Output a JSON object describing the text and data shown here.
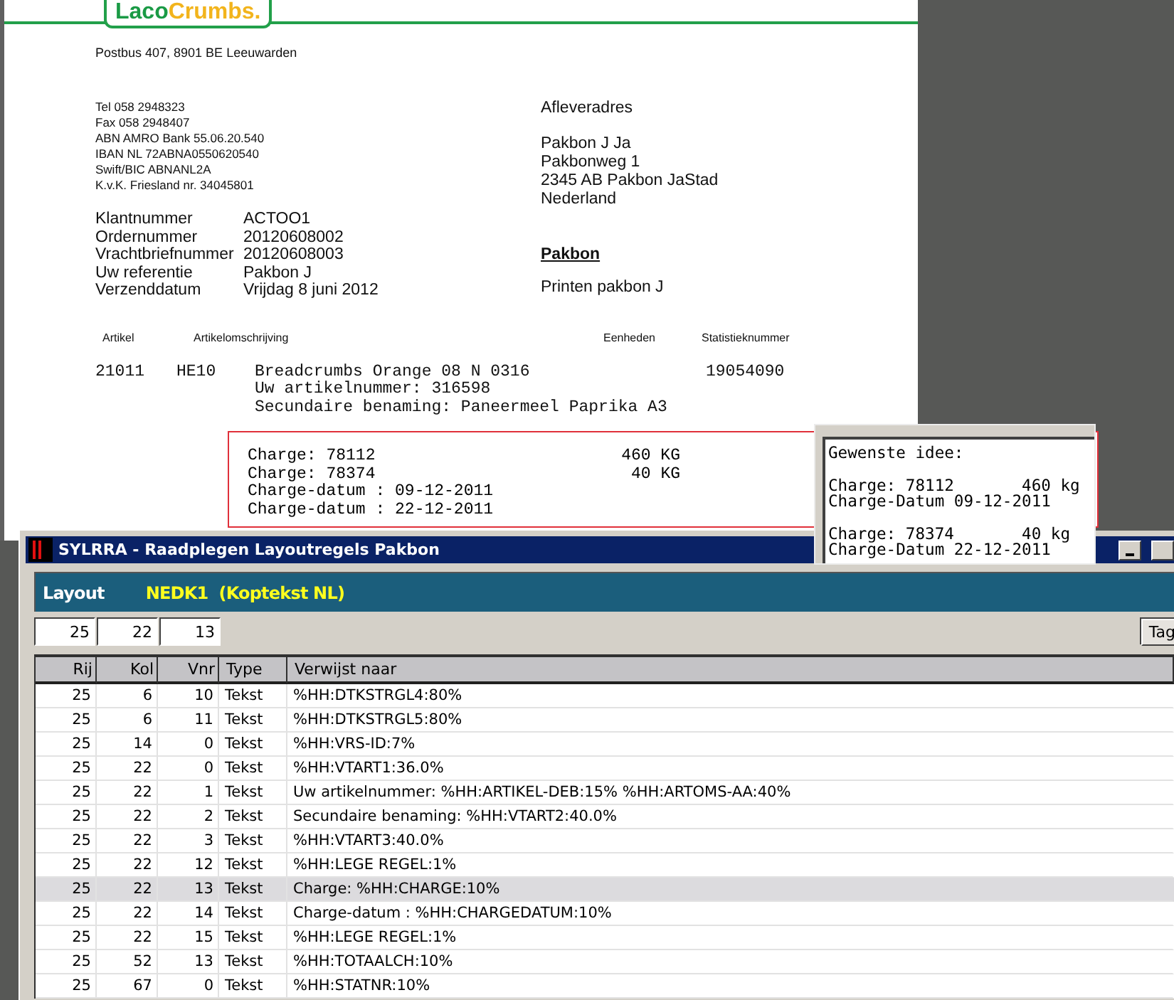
{
  "document": {
    "logo": {
      "first": "Laco",
      "second": "Crumbs."
    },
    "postal_address": "Postbus 407, 8901 BE Leeuwarden",
    "contact_lines": [
      "Tel 058 2948323",
      "Fax 058 2948407",
      "ABN AMRO Bank 55.06.20.540",
      "IBAN NL 72ABNA0550620540",
      "Swift/BIC ABNANL2A",
      "K.v.K. Friesland nr. 34045801"
    ],
    "order_fields": [
      {
        "label": "Klantnummer",
        "value": "ACTOO1"
      },
      {
        "label": "Ordernummer",
        "value": "20120608002"
      },
      {
        "label": "Vrachtbriefnummer",
        "value": "20120608003"
      },
      {
        "label": "Uw referentie",
        "value": "Pakbon J"
      },
      {
        "label": "Verzenddatum",
        "value": "Vrijdag 8 juni 2012"
      }
    ],
    "delivery": {
      "heading": "Afleveradres",
      "lines": [
        "Pakbon J Ja",
        "Pakbonweg 1",
        "2345 AB  Pakbon JaStad",
        "Nederland"
      ]
    },
    "doc_title": "Pakbon",
    "doc_subtitle": "Printen pakbon J",
    "columns": [
      "Artikel",
      "Artikelomschrijving",
      "Eenheden",
      "Statistieknummer"
    ],
    "item": {
      "article": "21011",
      "code": "HE10",
      "description_lines": [
        "Breadcrumbs Orange 08 N 0316",
        "Uw artikelnummer: 316598",
        "Secundaire benaming: Paneermeel Paprika A3"
      ],
      "stat_number": "19054090"
    }
  },
  "charges": [
    {
      "text": "Charge: 78112",
      "amount": "460 KG"
    },
    {
      "text": "Charge: 78374",
      "amount": "40 KG"
    },
    {
      "text": "Charge-datum : 09-12-2011"
    },
    {
      "text": "Charge-datum : 22-12-2011"
    }
  ],
  "note": {
    "blocks": [
      [
        "Gewenste idee:"
      ],
      [
        "Charge: 78112       460 kg",
        "Charge-Datum 09-12-2011"
      ],
      [
        "Charge: 78374       40 kg",
        "Charge-Datum 22-12-2011"
      ]
    ]
  },
  "app_window": {
    "title": "SYLRRA - Raadplegen Layoutregels Pakbon",
    "layout_label": "Layout",
    "layout_value": "NEDK1  (Koptekst NL)",
    "filters": [
      "25",
      "22",
      "13"
    ],
    "tag_button": "Tag",
    "table": {
      "columns": [
        "Rij",
        "Kol",
        "Vnr",
        "Type",
        "Verwijst naar"
      ],
      "rows": [
        {
          "cells": [
            "25",
            "6",
            "10",
            "Tekst",
            "%HH:DTKSTRGL4:80%"
          ],
          "selected": false
        },
        {
          "cells": [
            "25",
            "6",
            "11",
            "Tekst",
            "%HH:DTKSTRGL5:80%"
          ],
          "selected": false
        },
        {
          "cells": [
            "25",
            "14",
            "0",
            "Tekst",
            "%HH:VRS-ID:7%"
          ],
          "selected": false
        },
        {
          "cells": [
            "25",
            "22",
            "0",
            "Tekst",
            "%HH:VTART1:36.0%"
          ],
          "selected": false
        },
        {
          "cells": [
            "25",
            "22",
            "1",
            "Tekst",
            "Uw artikelnummer: %HH:ARTIKEL-DEB:15%  %HH:ARTOMS-AA:40%"
          ],
          "selected": false
        },
        {
          "cells": [
            "25",
            "22",
            "2",
            "Tekst",
            "Secundaire benaming: %HH:VTART2:40.0%"
          ],
          "selected": false
        },
        {
          "cells": [
            "25",
            "22",
            "3",
            "Tekst",
            "%HH:VTART3:40.0%"
          ],
          "selected": false
        },
        {
          "cells": [
            "25",
            "22",
            "12",
            "Tekst",
            "%HH:LEGE REGEL:1%"
          ],
          "selected": false
        },
        {
          "cells": [
            "25",
            "22",
            "13",
            "Tekst",
            "Charge: %HH:CHARGE:10%"
          ],
          "selected": true
        },
        {
          "cells": [
            "25",
            "22",
            "14",
            "Tekst",
            "Charge-datum : %HH:CHARGEDATUM:10%"
          ],
          "selected": false
        },
        {
          "cells": [
            "25",
            "22",
            "15",
            "Tekst",
            "%HH:LEGE REGEL:1%"
          ],
          "selected": false
        },
        {
          "cells": [
            "25",
            "52",
            "13",
            "Tekst",
            "%HH:TOTAALCH:10%"
          ],
          "selected": false
        },
        {
          "cells": [
            "25",
            "67",
            "0",
            "Tekst",
            "%HH:STATNR:10%"
          ],
          "selected": false
        }
      ]
    }
  }
}
